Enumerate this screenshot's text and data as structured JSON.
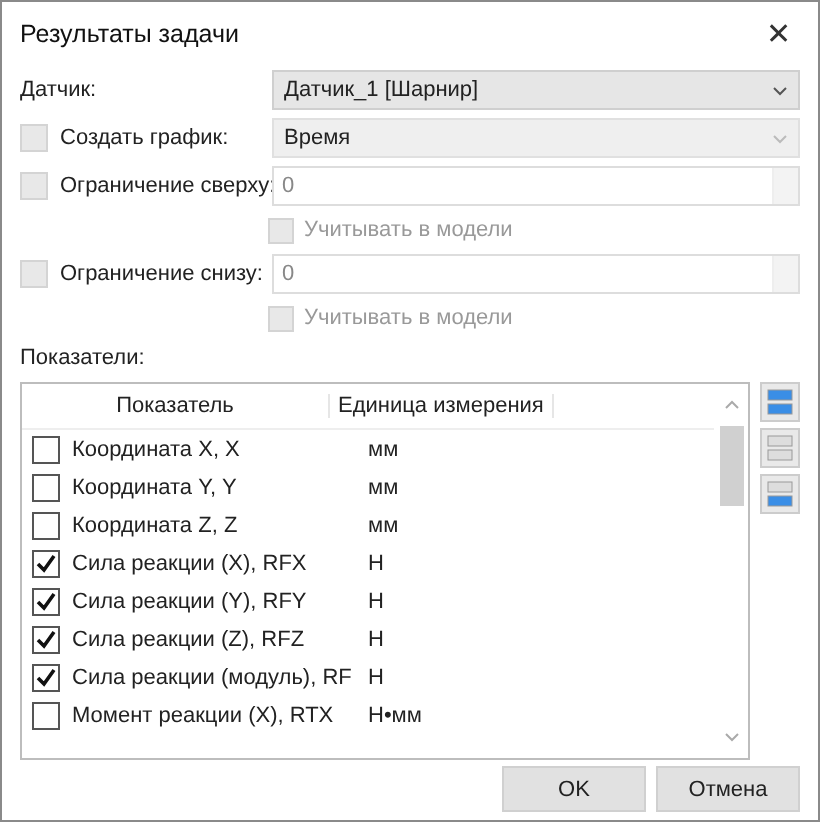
{
  "window": {
    "title": "Результаты задачи",
    "close": "✕"
  },
  "sensor": {
    "label": "Датчик:",
    "value": "Датчик_1 [Шарнир]"
  },
  "create_chart": {
    "label": "Создать график:",
    "checked": false,
    "value": "Время",
    "disabled": true
  },
  "limits": [
    {
      "label": "Ограничение сверху:",
      "checked": false,
      "value": "0",
      "consider_label": "Учитывать в модели",
      "consider_checked": false
    },
    {
      "label": "Ограничение снизу:",
      "checked": false,
      "value": "0",
      "consider_label": "Учитывать в модели",
      "consider_checked": false
    }
  ],
  "indicators": {
    "label": "Показатели:",
    "columns": [
      "Показатель",
      "Единица измерения"
    ],
    "rows": [
      {
        "name": "Координата X, X",
        "unit": "мм",
        "checked": false
      },
      {
        "name": "Координата Y, Y",
        "unit": "мм",
        "checked": false
      },
      {
        "name": "Координата Z, Z",
        "unit": "мм",
        "checked": false
      },
      {
        "name": "Сила реакции (X), RFX",
        "unit": "Н",
        "checked": true
      },
      {
        "name": "Сила реакции (Y), RFY",
        "unit": "Н",
        "checked": true
      },
      {
        "name": "Сила реакции (Z), RFZ",
        "unit": "Н",
        "checked": true
      },
      {
        "name": "Сила реакции (модуль), RF",
        "unit": "Н",
        "checked": true
      },
      {
        "name": "Момент реакции (X), RTX",
        "unit": "Н•мм",
        "checked": false
      }
    ]
  },
  "buttons": [
    "OK",
    "Отмена"
  ]
}
